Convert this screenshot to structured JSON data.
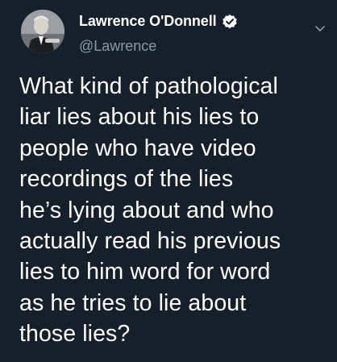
{
  "account": {
    "display_name": "Lawrence O'Donnell",
    "handle": "@Lawrence",
    "verified": true,
    "avatar_icon": "profile-photo",
    "verified_icon": "verified-badge-icon",
    "menu_icon": "chevron-down-icon"
  },
  "tweet": {
    "lines": [
      "What kind of pathological",
      "liar lies about his lies to",
      "people who have video",
      "recordings of the lies",
      "he’s lying about and who",
      "actually read his previous",
      "lies to him word for word",
      "as he tries to lie about",
      "those lies?"
    ]
  },
  "colors": {
    "background": "#15202b",
    "text": "#ffffff",
    "secondary_text": "#8899a6",
    "verified_badge": "#ffffff"
  }
}
